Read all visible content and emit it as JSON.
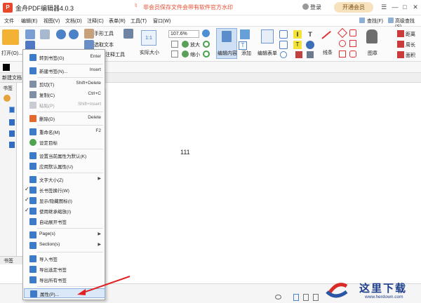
{
  "title_bar": {
    "app_title": "金舟PDF编辑器4.0.3",
    "promo_text": "非会员保存文件会带有软件官方水印",
    "login_label": "登录",
    "vip_button": "开通会员",
    "accent": "#e64b2e"
  },
  "menu": {
    "items": [
      "文件",
      "编辑(E)",
      "视图(V)",
      "文档(D)",
      "注释(C)",
      "表单(R)",
      "工具(T)",
      "窗口(W)"
    ],
    "right_items": [
      "查找(F)",
      "高级查找(S)"
    ]
  },
  "ribbon": {
    "open_label": "打开(O)...",
    "hand_tool": "手形工具",
    "select_text": "选取文本",
    "annotation_tool": "注释工具",
    "actual_size": "实际大小",
    "zoom_value": "107.6%",
    "zoom_in": "放大",
    "zoom_out": "缩小",
    "edit_content": "编辑内容",
    "add": "添加",
    "edit_form": "编辑表单",
    "line": "线条",
    "stamp": "图章",
    "distance": "距离",
    "perimeter": "周长",
    "area": "面积"
  },
  "tabs": {
    "doc_tab": "新建文档"
  },
  "left_panel": {
    "header": "书签",
    "bottom_label": "书签"
  },
  "document": {
    "page_text": "111"
  },
  "context_menu": {
    "items": [
      {
        "label": "转到书签(G)",
        "shortcut": "Enter",
        "disabled": false
      },
      {
        "label": "新建书签(N)...",
        "shortcut": "Insert",
        "disabled": false
      },
      {
        "label": "剪切(T)",
        "shortcut": "Shift+Delete",
        "disabled": false
      },
      {
        "label": "复制(C)",
        "shortcut": "Ctrl+C",
        "disabled": false
      },
      {
        "label": "粘贴(P)",
        "shortcut": "Shift+Insert",
        "disabled": true
      },
      {
        "label": "删除(D)",
        "shortcut": "Delete",
        "disabled": false
      },
      {
        "label": "重命名(M)",
        "shortcut": "F2",
        "disabled": false
      },
      {
        "label": "设定目标",
        "shortcut": "",
        "disabled": false
      },
      {
        "label": "设置当前属性为默认(K)",
        "shortcut": "",
        "disabled": false
      },
      {
        "label": "应用默认属性(U)",
        "shortcut": "",
        "disabled": false
      },
      {
        "label": "文字大小(Z)",
        "shortcut": "",
        "disabled": false
      },
      {
        "label": "长书签换行(W)",
        "shortcut": "",
        "disabled": false
      },
      {
        "label": "显示/隐藏图标(I)",
        "shortcut": "",
        "disabled": false
      },
      {
        "label": "使用继承缩放(I)",
        "shortcut": "",
        "disabled": false
      },
      {
        "label": "自动展开书签",
        "shortcut": "",
        "disabled": false
      },
      {
        "label": "Page(s)",
        "shortcut": "",
        "disabled": false
      },
      {
        "label": "Section(s)",
        "shortcut": "",
        "disabled": false
      },
      {
        "label": "导入书签",
        "shortcut": "",
        "disabled": false
      },
      {
        "label": "导出选定书签",
        "shortcut": "",
        "disabled": false
      },
      {
        "label": "导出所有书签",
        "shortcut": "",
        "disabled": false
      },
      {
        "label": "属性(P)...",
        "shortcut": "",
        "disabled": false
      }
    ]
  },
  "watermark": {
    "text": "这里下载",
    "url": "www.herdown.com"
  }
}
